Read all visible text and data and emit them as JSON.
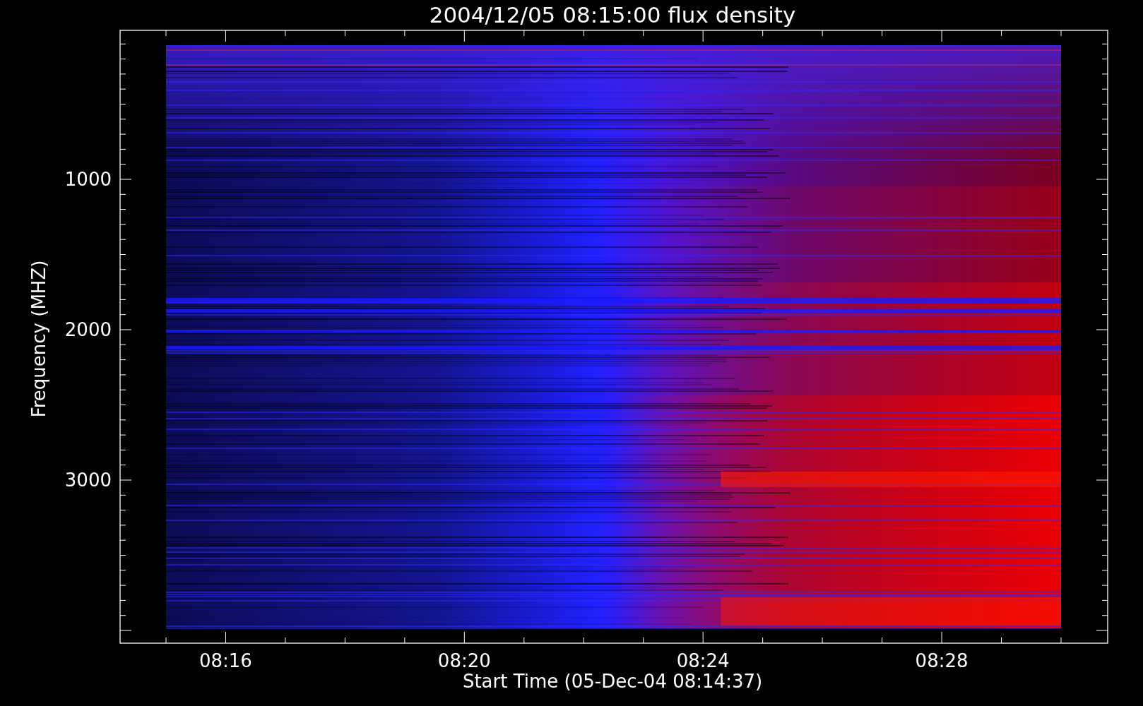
{
  "title": "2004/12/05 08:15:00 flux density",
  "y_axis": {
    "label": "Frequency (MHZ)",
    "tick_labels": [
      "1000",
      "2000",
      "3000"
    ]
  },
  "x_axis": {
    "label": "Start Time (05-Dec-04 08:14:37)",
    "tick_labels": [
      "08:16",
      "08:20",
      "08:24",
      "08:28"
    ]
  }
}
